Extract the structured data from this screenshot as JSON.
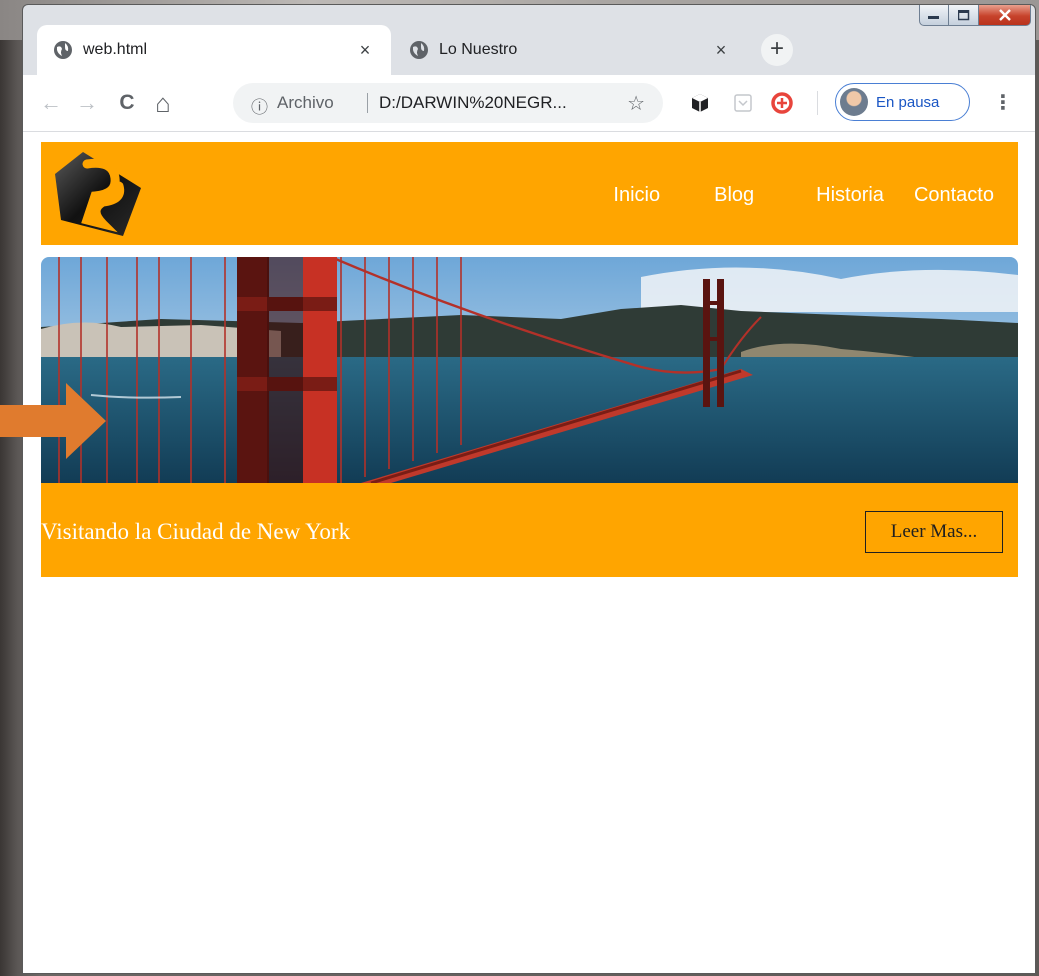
{
  "browser": {
    "tabs": [
      {
        "title": "web.html",
        "close": "×"
      },
      {
        "title": "Lo Nuestro",
        "close": "×"
      }
    ],
    "new_tab": "+",
    "toolbar": {
      "back": "←",
      "forward": "→",
      "reload": "C",
      "home": "⌂",
      "info_icon": "ⓘ",
      "site_label": "Archivo",
      "url": "D:/DARWIN%20NEGR...",
      "star": "☆",
      "profile_label": "En pausa",
      "menu": "⋮"
    }
  },
  "site": {
    "nav": [
      "Inicio",
      "Blog",
      "Historia",
      "Contacto"
    ],
    "caption_title": "Visitando la Ciudad de New York",
    "read_more": "Leer Mas..."
  },
  "colors": {
    "accent": "#ffa500",
    "arrow": "#e07b2e"
  }
}
